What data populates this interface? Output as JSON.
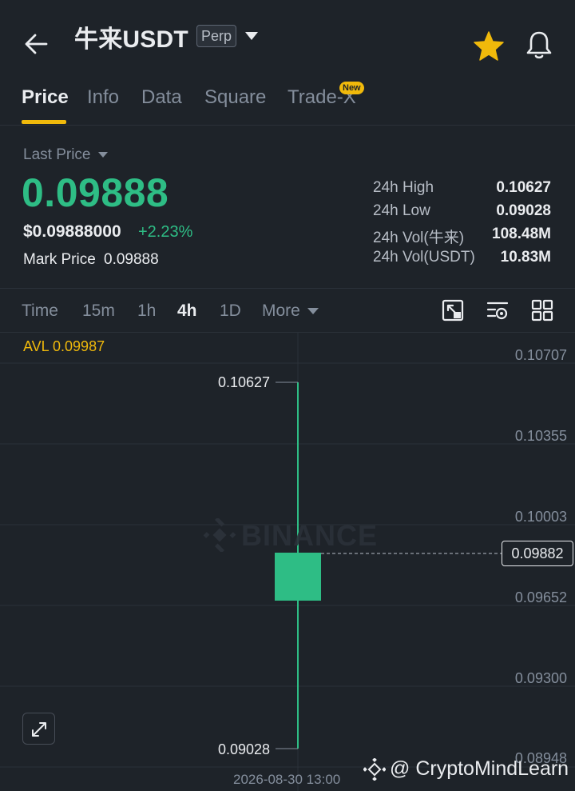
{
  "header": {
    "title": "牛来USDT",
    "badge": "Perp"
  },
  "tabs": [
    {
      "label": "Price",
      "active": true
    },
    {
      "label": "Info"
    },
    {
      "label": "Data"
    },
    {
      "label": "Square"
    },
    {
      "label": "Trade-X",
      "badge": "New"
    }
  ],
  "price": {
    "last_price_label": "Last Price",
    "last_price": "0.09888",
    "usd_price": "$0.09888000",
    "change_pct": "+2.23%",
    "mark_label": "Mark Price",
    "mark_value": "0.09888",
    "stats": [
      {
        "label": "24h High",
        "value": "0.10627"
      },
      {
        "label": "24h Low",
        "value": "0.09028"
      },
      {
        "label": "24h Vol(牛来)",
        "value": "108.48M"
      },
      {
        "label": "24h Vol(USDT)",
        "value": "10.83M"
      }
    ]
  },
  "intervals": [
    {
      "label": "Time"
    },
    {
      "label": "15m"
    },
    {
      "label": "1h"
    },
    {
      "label": "4h",
      "active": true
    },
    {
      "label": "1D"
    },
    {
      "label": "More"
    }
  ],
  "chart": {
    "avl_label": "AVL 0.09987",
    "y_ticks": [
      "0.10707",
      "0.10355",
      "0.10003",
      "0.09652",
      "0.09300",
      "0.08948"
    ],
    "current_price_tag": "0.09882",
    "high_label": "0.10627",
    "low_label": "0.09028",
    "time_label": "2026-08-30 13:00",
    "watermark": "BINANCE",
    "colors": {
      "up": "#2ebd85",
      "accent": "#f0b90b"
    }
  },
  "credit": "@ CryptoMindLearn"
}
